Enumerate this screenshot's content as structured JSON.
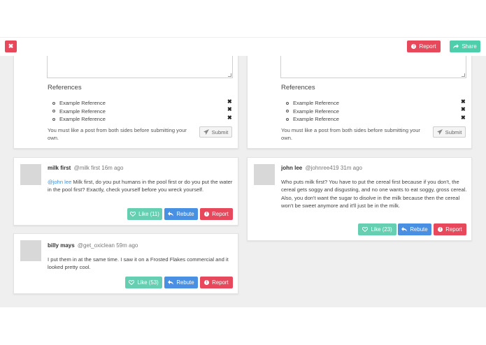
{
  "toolbar": {
    "close_glyph": "✖",
    "report_label": "Report",
    "share_label": "Share"
  },
  "compose": {
    "references_title": "References",
    "references": [
      "Example Reference",
      "Example Reference",
      "Example Reference"
    ],
    "remove_glyph": "✖",
    "hint": "You must like a post from both sides before submitting your own.",
    "submit_label": "Submit"
  },
  "left_posts": [
    {
      "name": "milk first",
      "handle": "@milk first",
      "time": "16m ago",
      "mention": "@john lee",
      "text": " Milk first, do you put humans in the pool first or do you put the water in the pool first? Exactly, check yourself before you wreck yourself.",
      "like_label": "Like (11)",
      "rebute_label": "Rebute",
      "report_label": "Report"
    },
    {
      "name": "billy mays",
      "handle": "@get_oxiclean",
      "time": "59m ago",
      "text": "I put them in at the same time. I saw it on a Frosted Flakes commercial and it looked pretty cool.",
      "like_label": "Like (53)",
      "rebute_label": "Rebute",
      "report_label": "Report"
    }
  ],
  "right_posts": [
    {
      "name": "john lee",
      "handle": "@johnree419",
      "time": "31m ago",
      "text": "Who puts milk first? You have to put the cereal first because if you don't, the cereal gets soggy and disgusting, and no one wants to eat soggy, gross cereal. Also, you don't want the sugar to disolve in the milk because then the cereal won't be sweet anymore and it'll just be in the milk.",
      "like_label": "Like (23)",
      "rebute_label": "Rebute",
      "report_label": "Report"
    }
  ],
  "colors": {
    "danger": "#e8485c",
    "success": "#4fceab",
    "like": "#66cfb2",
    "primary": "#4a90e2",
    "link": "#3b8fd9"
  },
  "icons": {
    "close": "close-icon",
    "report": "exclamation-circle-icon",
    "share": "share-arrow-icon",
    "submit": "paper-plane-icon",
    "like": "heart-outline-icon",
    "rebute": "reply-arrow-icon",
    "remove": "x-icon"
  }
}
